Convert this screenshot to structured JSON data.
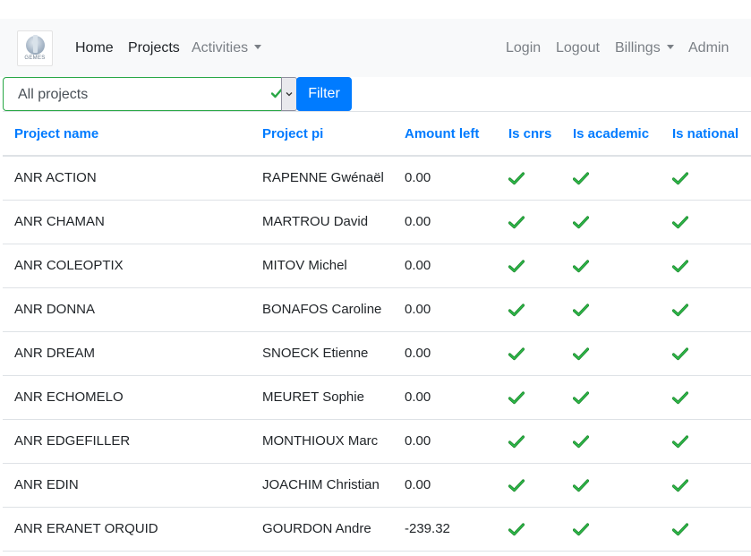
{
  "navbar": {
    "logo_text": "GEMES",
    "left_items": [
      {
        "label": "Home"
      },
      {
        "label": "Projects"
      },
      {
        "label": "Activities"
      }
    ],
    "right_items": [
      {
        "label": "Login"
      },
      {
        "label": "Logout"
      },
      {
        "label": "Billings"
      },
      {
        "label": "Admin"
      }
    ]
  },
  "filter": {
    "select_value": "All projects",
    "button_label": "Filter"
  },
  "table": {
    "columns": [
      "Project name",
      "Project pi",
      "Amount left",
      "Is cnrs",
      "Is academic",
      "Is national"
    ],
    "rows": [
      {
        "name": "ANR ACTION",
        "pi": "RAPENNE Gwénaël",
        "amount": "0.00",
        "cnrs": true,
        "academic": true,
        "national": true
      },
      {
        "name": "ANR CHAMAN",
        "pi": "MARTROU David",
        "amount": "0.00",
        "cnrs": true,
        "academic": true,
        "national": true
      },
      {
        "name": "ANR COLEOPTIX",
        "pi": "MITOV Michel",
        "amount": "0.00",
        "cnrs": true,
        "academic": true,
        "national": true
      },
      {
        "name": "ANR DONNA",
        "pi": "BONAFOS Caroline",
        "amount": "0.00",
        "cnrs": true,
        "academic": true,
        "national": true
      },
      {
        "name": "ANR DREAM",
        "pi": "SNOECK Etienne",
        "amount": "0.00",
        "cnrs": true,
        "academic": true,
        "national": true
      },
      {
        "name": "ANR ECHOMELO",
        "pi": "MEURET Sophie",
        "amount": "0.00",
        "cnrs": true,
        "academic": true,
        "national": true
      },
      {
        "name": "ANR EDGEFILLER",
        "pi": "MONTHIOUX Marc",
        "amount": "0.00",
        "cnrs": true,
        "academic": true,
        "national": true
      },
      {
        "name": "ANR EDIN",
        "pi": "JOACHIM Christian",
        "amount": "0.00",
        "cnrs": true,
        "academic": true,
        "national": true
      },
      {
        "name": "ANR ERANET ORQUID",
        "pi": "GOURDON Andre",
        "amount": "-239.32",
        "cnrs": true,
        "academic": true,
        "national": true
      }
    ]
  },
  "colors": {
    "accent": "#007bff",
    "check": "#28a745",
    "navbar_bg": "#f8f9fa"
  },
  "icons": {
    "logo": "gemes-logo-icon",
    "check": "check-icon",
    "dropdown": "caret-down-icon"
  }
}
